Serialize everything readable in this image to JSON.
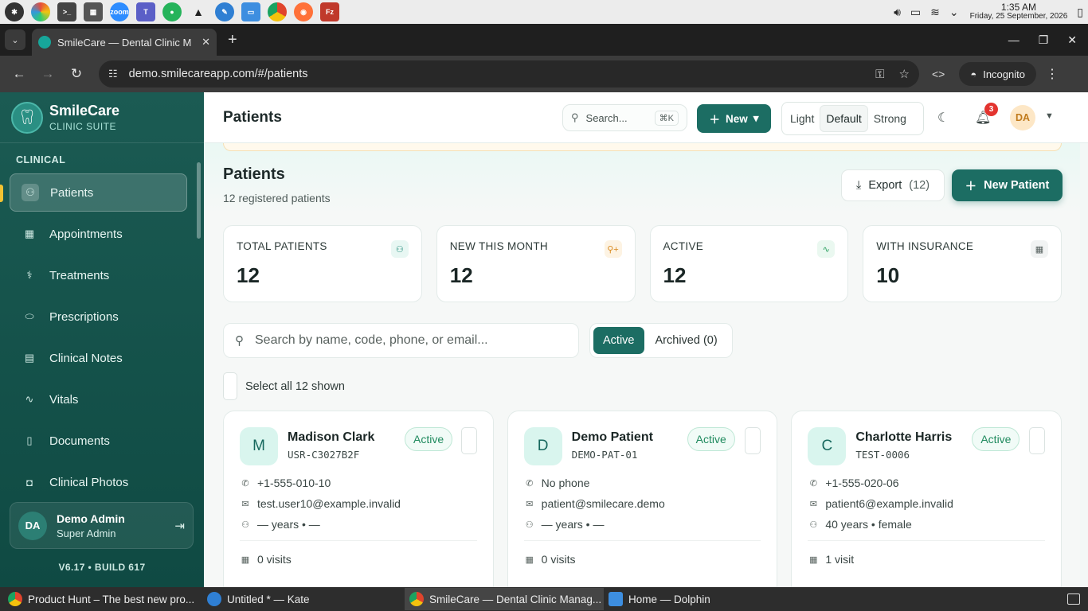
{
  "os": {
    "time": "1:35 AM",
    "date": "Friday, 25 September, 2026"
  },
  "browser": {
    "tab_title": "SmileCare — Dental Clinic M",
    "url": "demo.smilecareapp.com/#/patients",
    "incognito_label": "Incognito"
  },
  "sidebar": {
    "brand_name": "SmileCare",
    "brand_sub": "CLINIC SUITE",
    "section": "CLINICAL",
    "items": [
      {
        "label": "Patients",
        "icon": "users-icon"
      },
      {
        "label": "Appointments",
        "icon": "calendar-icon"
      },
      {
        "label": "Treatments",
        "icon": "stethoscope-icon"
      },
      {
        "label": "Prescriptions",
        "icon": "pill-icon"
      },
      {
        "label": "Clinical Notes",
        "icon": "clipboard-icon"
      },
      {
        "label": "Vitals",
        "icon": "activity-icon"
      },
      {
        "label": "Documents",
        "icon": "document-icon"
      },
      {
        "label": "Clinical Photos",
        "icon": "camera-icon"
      }
    ],
    "user": {
      "initials": "DA",
      "name": "Demo Admin",
      "role": "Super Admin"
    },
    "version": "V6.17 • BUILD 617"
  },
  "header": {
    "title": "Patients",
    "search_label": "Search...",
    "search_shortcut": "⌘K",
    "new_label": "New",
    "density": [
      "Light",
      "Default",
      "Strong"
    ],
    "density_selected": "Default",
    "notifications": "3",
    "avatar_initials": "DA"
  },
  "main": {
    "title": "Patients",
    "subtitle": "12 registered patients",
    "export_label": "Export",
    "export_count": "(12)",
    "new_patient_label": "New Patient",
    "stats": [
      {
        "label": "TOTAL PATIENTS",
        "value": "12",
        "icon": "users-icon",
        "color": "#1f8a7a",
        "bg": "#e8f7f3"
      },
      {
        "label": "NEW THIS MONTH",
        "value": "12",
        "icon": "user-plus-icon",
        "color": "#d98a1f",
        "bg": "#fdf3e3"
      },
      {
        "label": "ACTIVE",
        "value": "12",
        "icon": "activity-icon",
        "color": "#2aa05f",
        "bg": "#eaf8f0"
      },
      {
        "label": "WITH INSURANCE",
        "value": "10",
        "icon": "calendar-icon",
        "color": "#55605e",
        "bg": "#f1f3f3"
      }
    ],
    "search_placeholder": "Search by name, code, phone, or email...",
    "filter_active": "Active",
    "filter_archived": "Archived (0)",
    "select_all": "Select all 12 shown",
    "patients": [
      {
        "initial": "M",
        "name": "Madison Clark",
        "code": "USR-C3027B2F",
        "status": "Active",
        "phone": "+1-555-010-10",
        "email": "test.user10@example.invalid",
        "demo": "— years • —",
        "visits": "0 visits"
      },
      {
        "initial": "D",
        "name": "Demo Patient",
        "code": "DEMO-PAT-01",
        "status": "Active",
        "phone": "No phone",
        "email": "patient@smilecare.demo",
        "demo": "— years • —",
        "visits": "0 visits"
      },
      {
        "initial": "C",
        "name": "Charlotte Harris",
        "code": "TEST-0006",
        "status": "Active",
        "phone": "+1-555-020-06",
        "email": "patient6@example.invalid",
        "demo": "40 years • female",
        "visits": "1 visit"
      }
    ]
  },
  "taskbar": [
    {
      "label": "Product Hunt – The best new pro...",
      "color": "#e0442c"
    },
    {
      "label": "Untitled * — Kate",
      "color": "#2f7fd3"
    },
    {
      "label": "SmileCare — Dental Clinic Manag...",
      "color": "#e0442c"
    },
    {
      "label": "Home — Dolphin",
      "color": "#3d8ee0"
    }
  ]
}
